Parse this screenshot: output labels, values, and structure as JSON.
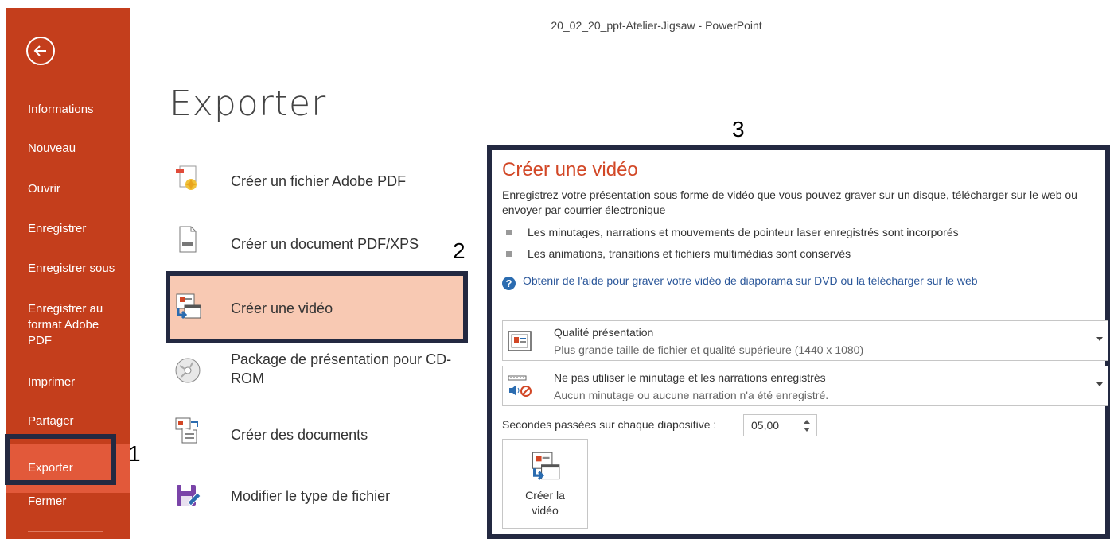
{
  "window": {
    "title": "20_02_20_ppt-Atelier-Jigsaw - PowerPoint"
  },
  "nav": {
    "back_icon": "back-arrow-circle-icon",
    "items": [
      {
        "label": "Informations"
      },
      {
        "label": "Nouveau"
      },
      {
        "label": "Ouvrir"
      },
      {
        "label": "Enregistrer"
      },
      {
        "label": "Enregistrer sous"
      },
      {
        "label": "Enregistrer au format Adobe PDF"
      },
      {
        "label": "Imprimer"
      },
      {
        "label": "Partager"
      },
      {
        "label": "Exporter",
        "active": true
      },
      {
        "label": "Fermer"
      }
    ],
    "accent_color": "#c43e1c",
    "active_color": "#e2593a"
  },
  "page": {
    "title": "Exporter"
  },
  "export_options": [
    {
      "label": "Créer un fichier Adobe PDF",
      "icon": "adobe-pdf-icon"
    },
    {
      "label": "Créer un document PDF/XPS",
      "icon": "pdf-xps-document-icon"
    },
    {
      "label": "Créer une vidéo",
      "icon": "video-icon",
      "selected": true
    },
    {
      "label": "Package de présentation pour CD-ROM",
      "icon": "cd-rom-icon"
    },
    {
      "label": "Créer des documents",
      "icon": "handouts-icon"
    },
    {
      "label": "Modifier le type de fichier",
      "icon": "save-as-filetype-icon"
    }
  ],
  "callouts": {
    "one": "1",
    "two": "2",
    "three": "3"
  },
  "panel": {
    "title": "Créer une vidéo",
    "description": "Enregistrez votre présentation sous forme de vidéo que vous pouvez graver sur un disque, télécharger sur le web ou envoyer par courrier électronique",
    "bullets": [
      "Les minutages, narrations et mouvements de pointeur laser enregistrés sont incorporés",
      "Les animations, transitions et fichiers multimédias sont conservés"
    ],
    "help_link": "Obtenir de l'aide pour graver votre vidéo de diaporama sur DVD ou la télécharger sur le web",
    "quality": {
      "title": "Qualité présentation",
      "subtitle": "Plus grande taille de fichier et qualité supérieure (1440 x 1080)"
    },
    "timing": {
      "title": "Ne pas utiliser le minutage et les narrations enregistrés",
      "subtitle": "Aucun minutage ou aucune narration n'a été enregistré."
    },
    "seconds_label": "Secondes passées sur chaque diapositive :",
    "seconds_value": "05,00",
    "create_button": {
      "line1": "Créer la",
      "line2": "vidéo"
    },
    "title_color": "#d24726",
    "link_color": "#2b579a"
  }
}
